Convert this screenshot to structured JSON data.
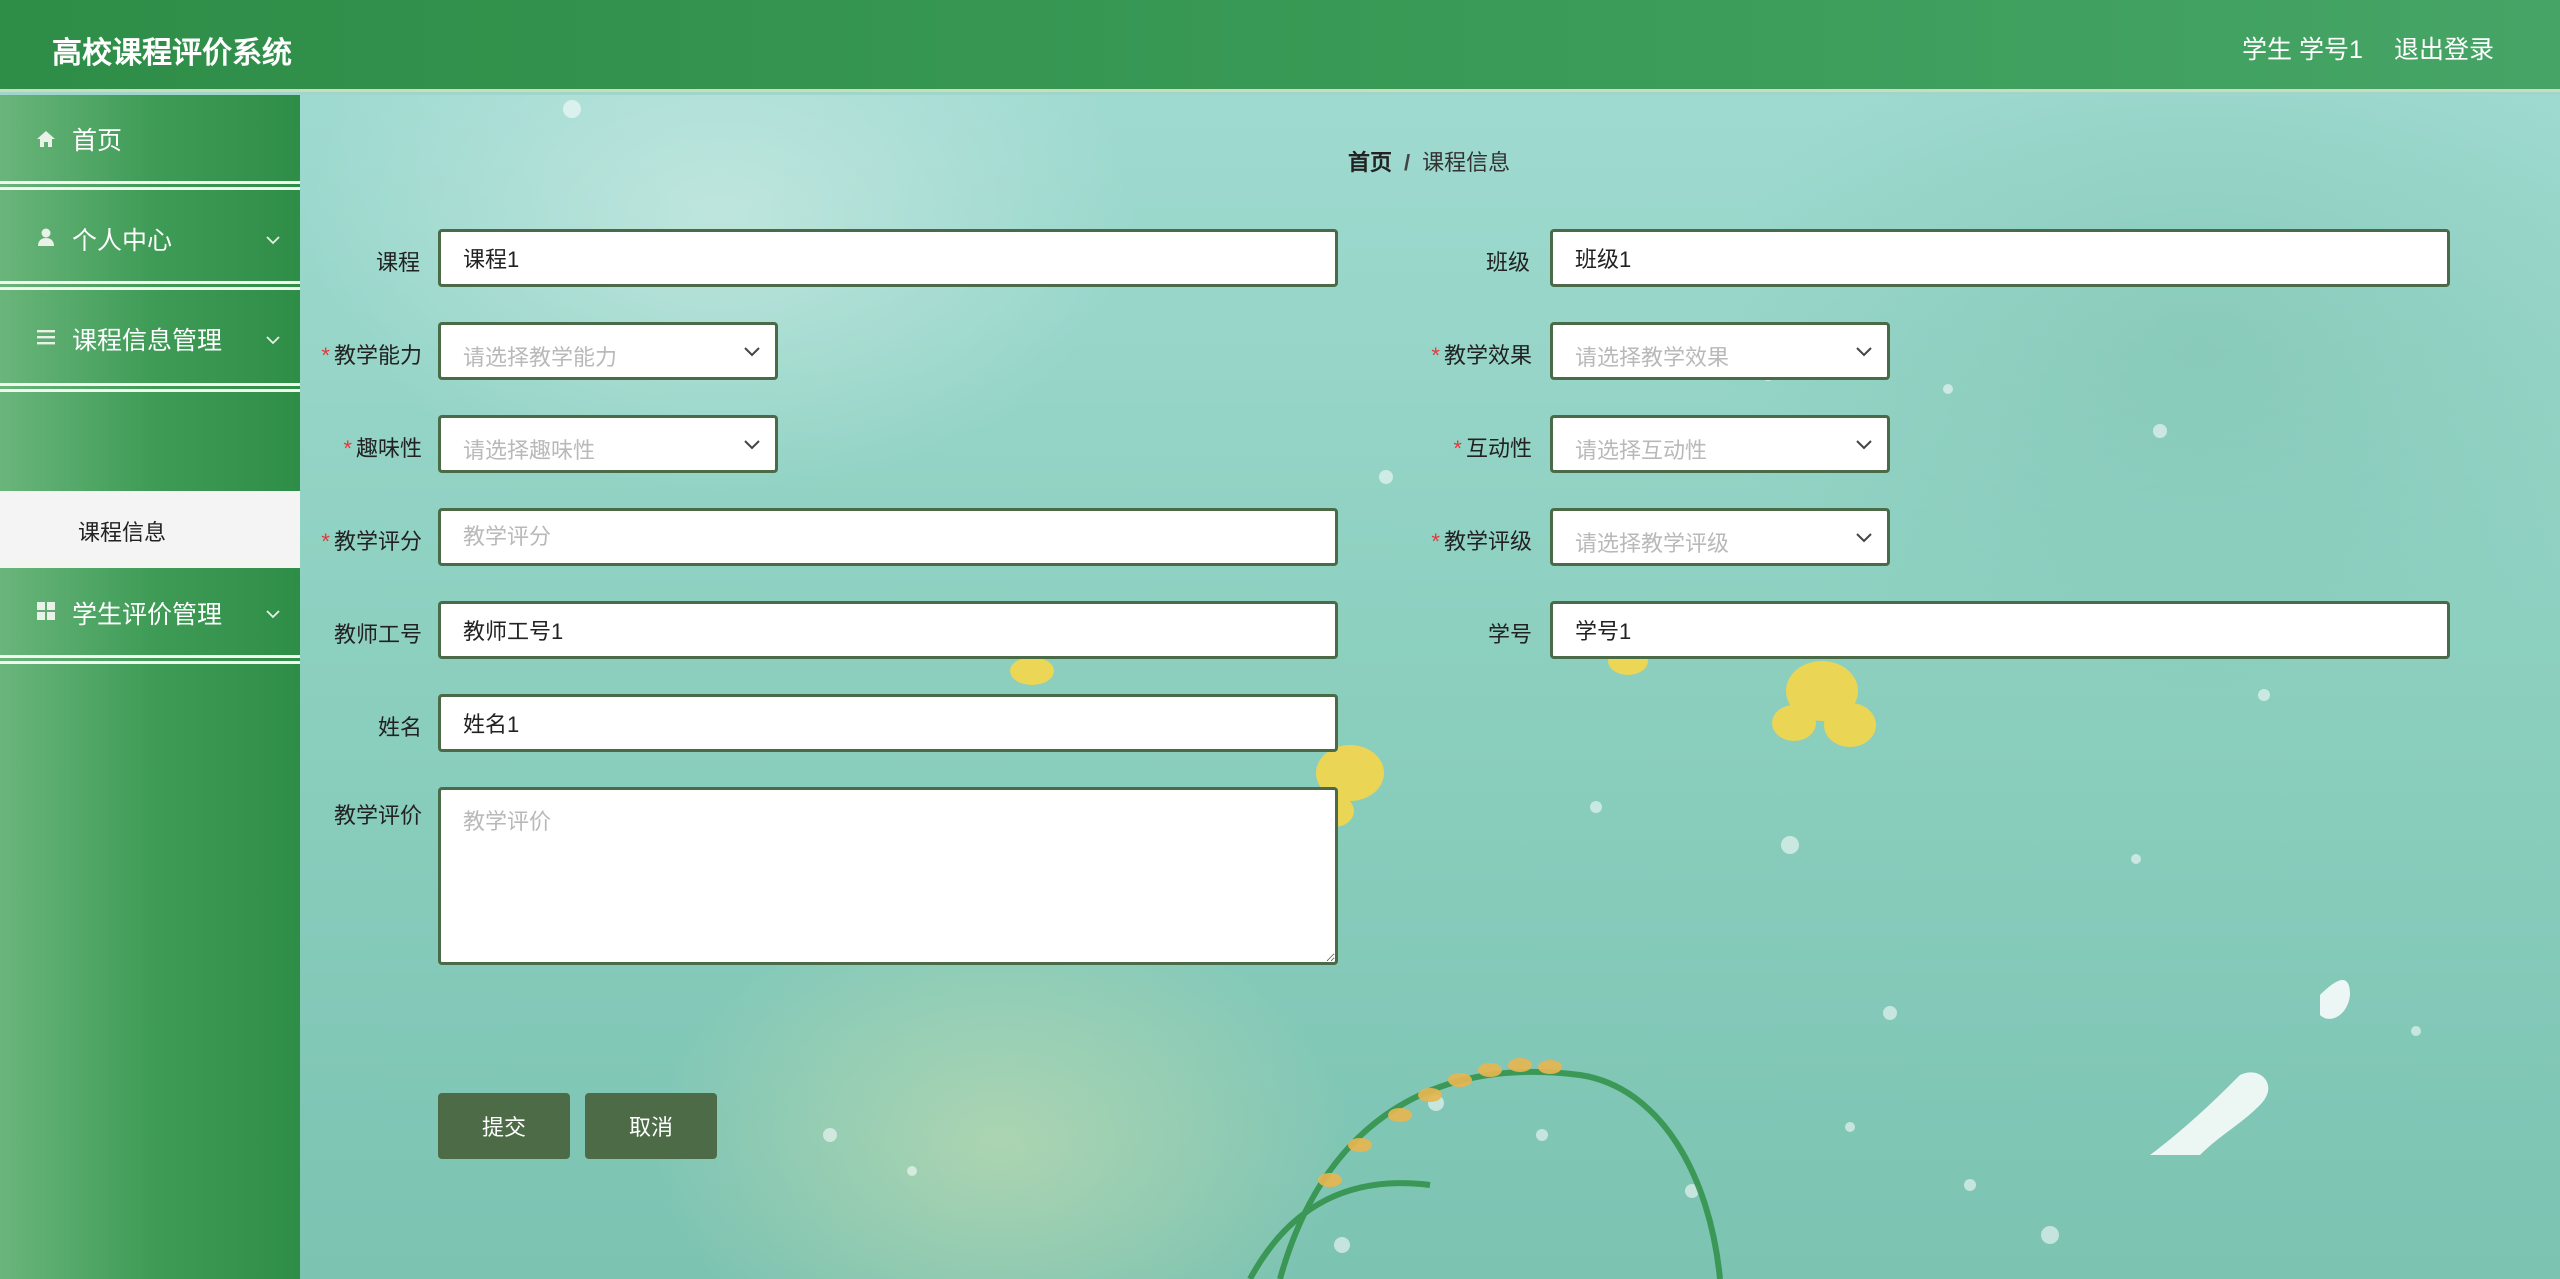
{
  "header": {
    "title": "高校课程评价系统",
    "user": "学生 学号1",
    "logout": "退出登录"
  },
  "sidebar": {
    "items": [
      {
        "label": "首页",
        "icon": "home-icon"
      },
      {
        "label": "个人中心",
        "icon": "user-icon"
      },
      {
        "label": "课程信息管理",
        "icon": "list-icon"
      },
      {
        "label": "学生评价管理",
        "icon": "grid-icon"
      }
    ],
    "sub_items": [
      {
        "label": "课程信息"
      }
    ]
  },
  "breadcrumb": {
    "home": "首页",
    "separator": "/",
    "current": "课程信息"
  },
  "form": {
    "course": {
      "label": "课程",
      "value": "课程1"
    },
    "class": {
      "label": "班级",
      "value": "班级1"
    },
    "teaching_ability": {
      "label": "教学能力",
      "placeholder": "请选择教学能力",
      "required": true
    },
    "teaching_effect": {
      "label": "教学效果",
      "placeholder": "请选择教学效果",
      "required": true
    },
    "interest": {
      "label": "趣味性",
      "placeholder": "请选择趣味性",
      "required": true
    },
    "interaction": {
      "label": "互动性",
      "placeholder": "请选择互动性",
      "required": true
    },
    "teaching_score": {
      "label": "教学评分",
      "placeholder": "教学评分",
      "required": true
    },
    "teaching_grade": {
      "label": "教学评级",
      "placeholder": "请选择教学评级",
      "required": true
    },
    "teacher_id": {
      "label": "教师工号",
      "value": "教师工号1"
    },
    "student_id": {
      "label": "学号",
      "value": "学号1"
    },
    "name": {
      "label": "姓名",
      "value": "姓名1"
    },
    "evaluation": {
      "label": "教学评价",
      "placeholder": "教学评价"
    },
    "required_mark": "*",
    "submit_label": "提交",
    "cancel_label": "取消"
  },
  "colors": {
    "primary": "#2e8d47",
    "field_border": "#4b6b48",
    "button": "#4d6b47",
    "required": "#e4393c"
  }
}
